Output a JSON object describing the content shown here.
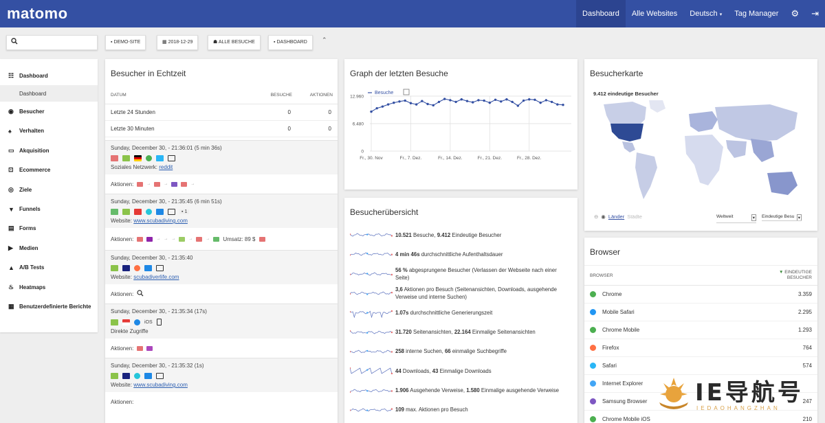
{
  "app": {
    "logo": "matomo"
  },
  "topnav": {
    "items": [
      "Dashboard",
      "Alle Websites",
      "Deutsch",
      "Tag Manager"
    ],
    "active": "Dashboard"
  },
  "toolbar": {
    "site": "DEMO-SITE",
    "date": "2018-12-29",
    "segment": "ALLE BESUCHE",
    "dashboard": "DASHBOARD"
  },
  "sidebar": {
    "dashboard": "Dashboard",
    "dashboard_sub": "Dashboard",
    "items": [
      "Besucher",
      "Verhalten",
      "Akquisition",
      "Ecommerce",
      "Ziele",
      "Funnels",
      "Forms",
      "Medien",
      "A/B Tests",
      "Heatmaps",
      "Benutzerdefinierte Berichte"
    ]
  },
  "realtime": {
    "title": "Besucher in Echtzeit",
    "headers": [
      "DATUM",
      "BESUCHE",
      "AKTIONEN"
    ],
    "rows": [
      {
        "label": "Letzte 24 Stunden",
        "visits": "0",
        "actions": "0"
      },
      {
        "label": "Letzte 30 Minuten",
        "visits": "0",
        "actions": "0"
      }
    ],
    "visits": [
      {
        "time": "Sunday, December 30, - 21:36:01 (5 min 36s)",
        "ref_label": "Soziales Netzwerk:",
        "ref_link": "reddit",
        "actions_label": "Aktionen:"
      },
      {
        "time": "Sunday, December 30, - 21:35:45 (6 min 51s)",
        "ref_label": "Website:",
        "ref_link": "www.scubadiving.com",
        "actions_label": "Aktionen:",
        "badge": "1",
        "revenue": "Umsatz: 89 $"
      },
      {
        "time": "Sunday, December 30, - 21:35:40",
        "ref_label": "Website:",
        "ref_link": "scubadiverlife.com",
        "actions_label": "Aktionen:"
      },
      {
        "time": "Sunday, December 30, - 21:35:34 (17s)",
        "ref_label": "Direkte Zugriffe",
        "ref_link": "",
        "actions_label": "Aktionen:",
        "os": "iOS"
      },
      {
        "time": "Sunday, December 30, - 21:35:32 (1s)",
        "ref_label": "Website:",
        "ref_link": "www.scubadiving.com",
        "actions_label": "Aktionen:"
      }
    ]
  },
  "graph": {
    "title": "Graph der letzten Besuche",
    "legend": "Besuche"
  },
  "chart_data": {
    "type": "line",
    "title": "Graph der letzten Besuche",
    "series": [
      {
        "name": "Besuche",
        "values": [
          9300,
          10100,
          10500,
          11000,
          11400,
          11700,
          11900,
          11300,
          11000,
          11800,
          11100,
          10800,
          11600,
          12300,
          12000,
          11600,
          12200,
          11800,
          11500,
          12000,
          11900,
          11400,
          12100,
          11700,
          12200,
          11600,
          10700,
          11900,
          12200,
          12100,
          11400,
          12000,
          11600,
          11000,
          10900
        ]
      }
    ],
    "x_labels": [
      "Fr., 30. Nov",
      "Fr., 7. Dez.",
      "Fr., 14. Dez.",
      "Fr., 21. Dez.",
      "Fr., 28. Dez."
    ],
    "y_ticks": [
      "12.960",
      "6.480",
      "0"
    ],
    "ylim": [
      0,
      12960
    ],
    "grid": true
  },
  "map": {
    "title": "Besucherkarte",
    "summary": "9.412 eindeutige Besucher",
    "tab_countries": "Länder",
    "tab_cities": "Städte",
    "region_select": "Weltweit",
    "metric_select": "Eindeutige Besu"
  },
  "overview": {
    "title": "Besucherübersicht",
    "rows": [
      {
        "b1": "10.521",
        "t1": " Besuche, ",
        "b2": "9.412",
        "t2": " Eindeutige Besucher"
      },
      {
        "b1": "4 min 46s",
        "t1": " durchschnittliche Aufenthaltsdauer",
        "b2": "",
        "t2": ""
      },
      {
        "b1": "56 %",
        "t1": " abgesprungene Besucher (Verlassen der Webseite nach einer Seite)",
        "b2": "",
        "t2": ""
      },
      {
        "b1": "3,6",
        "t1": " Aktionen pro Besuch (Seitenansichten, Downloads, ausgehende Verweise und interne Suchen)",
        "b2": "",
        "t2": ""
      },
      {
        "b1": "1.07s",
        "t1": " durchschnittliche Generierungszeit",
        "b2": "",
        "t2": ""
      },
      {
        "b1": "31.720",
        "t1": " Seitenansichten, ",
        "b2": "22.164",
        "t2": " Einmalige Seitenansichten"
      },
      {
        "b1": "258",
        "t1": " interne Suchen, ",
        "b2": "66",
        "t2": " einmalige Suchbegriffe"
      },
      {
        "b1": "44",
        "t1": " Downloads, ",
        "b2": "43",
        "t2": " Einmalige Downloads"
      },
      {
        "b1": "1.906",
        "t1": " Ausgehende Verweise, ",
        "b2": "1.580",
        "t2": " Einmalige ausgehende Verweise"
      },
      {
        "b1": "109",
        "t1": " max. Aktionen pro Besuch",
        "b2": "",
        "t2": ""
      }
    ]
  },
  "browser": {
    "title": "Browser",
    "col1": "BROWSER",
    "col2": "EINDEUTIGE BESUCHER",
    "rows": [
      {
        "name": "Chrome",
        "value": "3.359",
        "color": "#4caf50"
      },
      {
        "name": "Mobile Safari",
        "value": "2.295",
        "color": "#2196f3"
      },
      {
        "name": "Chrome Mobile",
        "value": "1.293",
        "color": "#4caf50"
      },
      {
        "name": "Firefox",
        "value": "764",
        "color": "#ff7043"
      },
      {
        "name": "Safari",
        "value": "574",
        "color": "#29b6f6"
      },
      {
        "name": "Internet Explorer",
        "value": "",
        "color": "#42a5f5"
      },
      {
        "name": "Samsung Browser",
        "value": "247",
        "color": "#7e57c2"
      },
      {
        "name": "Chrome Mobile iOS",
        "value": "210",
        "color": "#4caf50"
      }
    ]
  },
  "watermark": {
    "text": "IE导航号",
    "sub": "IEDAOHANGZHAN"
  }
}
